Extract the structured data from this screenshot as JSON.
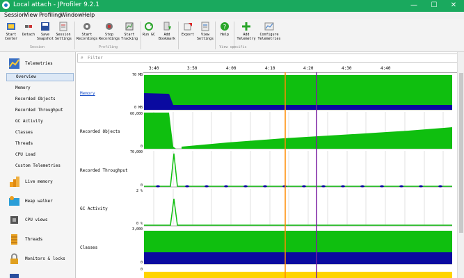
{
  "window": {
    "title": "Local attach - JProfiler 9.2.1",
    "minimize": "—",
    "maximize": "☐",
    "close": "✕"
  },
  "menu": [
    "Session",
    "View",
    "Profiling",
    "Window",
    "Help"
  ],
  "toolbar": {
    "buttons": [
      {
        "label": "Start\nCenter",
        "icon": "start-center-icon"
      },
      {
        "label": "Detach",
        "icon": "detach-icon"
      },
      {
        "label": "Save\nSnapshot",
        "icon": "save-snapshot-icon"
      },
      {
        "label": "Session\nSettings",
        "icon": "session-settings-icon"
      },
      {
        "label": "Start\nRecordings",
        "icon": "start-recordings-icon"
      },
      {
        "label": "Stop\nRecordings",
        "icon": "stop-recordings-icon"
      },
      {
        "label": "Start\nTracking",
        "icon": "start-tracking-icon"
      },
      {
        "label": "Run GC",
        "icon": "run-gc-icon"
      },
      {
        "label": "Add\nBookmark",
        "icon": "add-bookmark-icon"
      },
      {
        "label": "Export",
        "icon": "export-icon"
      },
      {
        "label": "View\nSettings",
        "icon": "view-settings-icon"
      },
      {
        "label": "Help",
        "icon": "help-icon"
      },
      {
        "label": "Add\nTelemetry",
        "icon": "add-telemetry-icon"
      },
      {
        "label": "Configure\nTelemetries",
        "icon": "configure-telemetries-icon"
      }
    ],
    "groups": {
      "session": "Session",
      "profiling": "Profiling",
      "view_specific": "View specific"
    }
  },
  "sidebar": {
    "sections": [
      {
        "label": "Telemetries",
        "icon": "telemetries-icon"
      },
      {
        "label": "Live memory",
        "icon": "live-memory-icon"
      },
      {
        "label": "Heap walker",
        "icon": "heap-walker-icon"
      },
      {
        "label": "CPU views",
        "icon": "cpu-views-icon"
      },
      {
        "label": "Threads",
        "icon": "threads-icon"
      },
      {
        "label": "Monitors & locks",
        "icon": "monitors-locks-icon"
      }
    ],
    "telemetry_items": [
      "Overview",
      "Memory",
      "Recorded Objects",
      "Recorded Throughput",
      "GC Activity",
      "Classes",
      "Threads",
      "CPU Load",
      "Custom Telemetries"
    ],
    "selected": "Overview"
  },
  "filter": {
    "placeholder": "Filter",
    "icon": "search-icon"
  },
  "timeline": {
    "ticks": [
      "3:40",
      "3:50",
      "4:00",
      "4:10",
      "4:20",
      "4:30",
      "4:40"
    ],
    "markers": {
      "orange": "#ff8c00",
      "purple": "#7a1fa2"
    }
  },
  "rows": [
    {
      "label": "Memory",
      "ymax": "70 MB",
      "ymin": "0 MB",
      "link": true
    },
    {
      "label": "Recorded Objects",
      "ymax": "60,000",
      "ymin": "0"
    },
    {
      "label": "Recorded Throughput",
      "ymax": "70,000",
      "ymin": "0"
    },
    {
      "label": "GC Activity",
      "ymax": "2 %",
      "ymin": "0 %"
    },
    {
      "label": "Classes",
      "ymax": "3,000",
      "ymin": "0"
    },
    {
      "label": "",
      "ymax": "",
      "ymin": "0"
    }
  ],
  "colors": {
    "green": "#0fbf0f",
    "blue": "#0a0aa0",
    "yellow": "#ffd400",
    "titlebar": "#1aa95e"
  }
}
